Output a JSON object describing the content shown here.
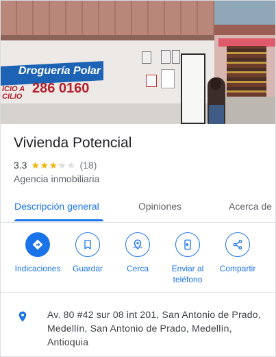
{
  "place": {
    "name": "Vivienda Potencial",
    "rating": "3.3",
    "rating_value": 3.3,
    "stars": [
      1,
      1,
      1,
      0.3,
      0
    ],
    "reviews": "(18)",
    "category": "Agencia inmobiliaria"
  },
  "photo": {
    "sign_name": "Droguería Polar",
    "sign_phone": "286 0160",
    "sign_sub_line1": "ICIO A",
    "sign_sub_line2": "CILIO"
  },
  "tabs": [
    {
      "label": "Descripción general",
      "active": true
    },
    {
      "label": "Opiniones",
      "active": false
    },
    {
      "label": "Acerca de",
      "active": false
    }
  ],
  "actions": [
    {
      "label": "Indicaciones",
      "icon": "directions-icon"
    },
    {
      "label": "Guardar",
      "icon": "bookmark-icon"
    },
    {
      "label": "Cerca",
      "icon": "nearby-icon"
    },
    {
      "label": "Enviar al teléfono",
      "icon": "send-to-phone-icon"
    },
    {
      "label": "Compartir",
      "icon": "share-icon"
    }
  ],
  "address": {
    "text": "Av. 80 #42 sur 08 int 201, San Antonio de Prado, Medellín, San Antonio de Prado, Medellín, Antioquia",
    "icon": "location-pin-icon"
  },
  "colors": {
    "accent": "#1a73e8",
    "star": "#f4b400",
    "star_empty": "#dadce0",
    "text": "#202124",
    "secondary": "#5f6368"
  }
}
